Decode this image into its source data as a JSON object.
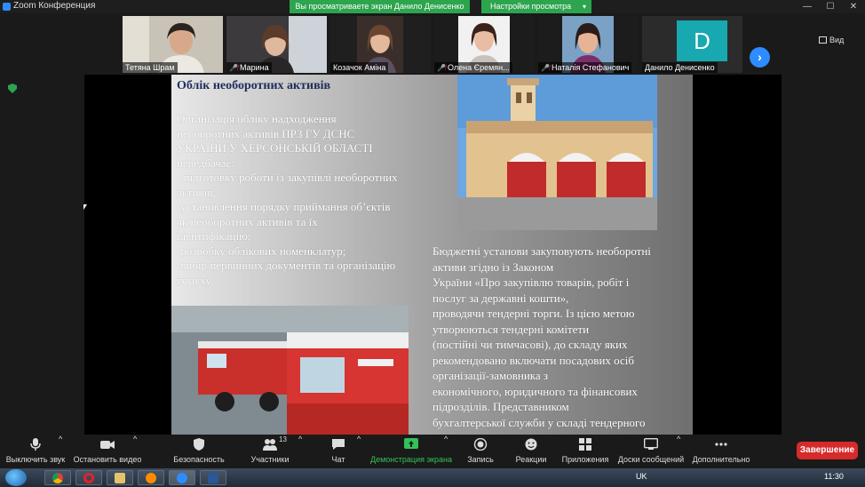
{
  "window": {
    "app_title": "Zoom Конференция",
    "share_banner": "Вы просматриваете экран Данило Денисенко",
    "view_options": "Настройки просмотра",
    "minimize": "—",
    "maximize": "☐",
    "close": "✕"
  },
  "participants": [
    {
      "name": "Тетяна Шрам",
      "muted": false
    },
    {
      "name": "Марина",
      "muted": true
    },
    {
      "name": "Козачок Аміна",
      "muted": false
    },
    {
      "name": "Олена Єремян...",
      "muted": true
    },
    {
      "name": "Наталія Стефанович",
      "muted": true
    },
    {
      "name": "Данило Денисенко",
      "muted": false,
      "avatar_letter": "D"
    }
  ],
  "muted_glyph": "🎤̸",
  "strip_next": "›",
  "view_label": "Вид",
  "slide": {
    "title": "Облік необоротних активів",
    "left_lines": [
      "Організація обліку надходження",
      "необоротних активів ПРЗ ГУ ДСНС",
      "УКРАЇНИ У ХЕРСОНСЬКІЙ ОБЛАСТІ",
      "передбачає:",
      "- підготовку роботи із закупівлі  необоротних",
      "активів;",
      "-установлення порядку приймання об’єктів",
      "як необоротних активів та їх",
      "ідентифікацію;",
      "-розробку облікових номенклатур;",
      "-вибір первинних документів та організацію",
      "їх руху."
    ],
    "right_lines": [
      "Бюджетні установи закуповують необоротні",
      "активи згідно із Законом",
      "України «Про закупівлю товарів, робіт і",
      "послуг за державні кошти»,",
      "проводячи тендерні торги. Із цією метою",
      "утворюються тендерні комітети",
      "(постійні чи тимчасові), до складу яких",
      "рекомендовано включати посадових осіб",
      "організації-замовника з",
      "економічного, юридичного та фінансових",
      "підрозділів. Представником",
      "бухгалтерської служби у складі тендерного"
    ]
  },
  "toolbar": {
    "mute": "Выключить звук",
    "video": "Остановить видео",
    "security": "Безопасность",
    "participants": "Участники",
    "participants_count": "13",
    "chat": "Чат",
    "share": "Демонстрация экрана",
    "record": "Запись",
    "reactions": "Реакции",
    "apps": "Приложения",
    "whiteboard": "Доски сообщений",
    "more": "Дополнительно",
    "end": "Завершение",
    "caret": "^"
  },
  "taskbar": {
    "lang": "UK",
    "time": "11:30"
  },
  "colors": {
    "accent_green": "#2da44e",
    "accent_blue": "#2d8cff",
    "end_red": "#d62b2b"
  }
}
